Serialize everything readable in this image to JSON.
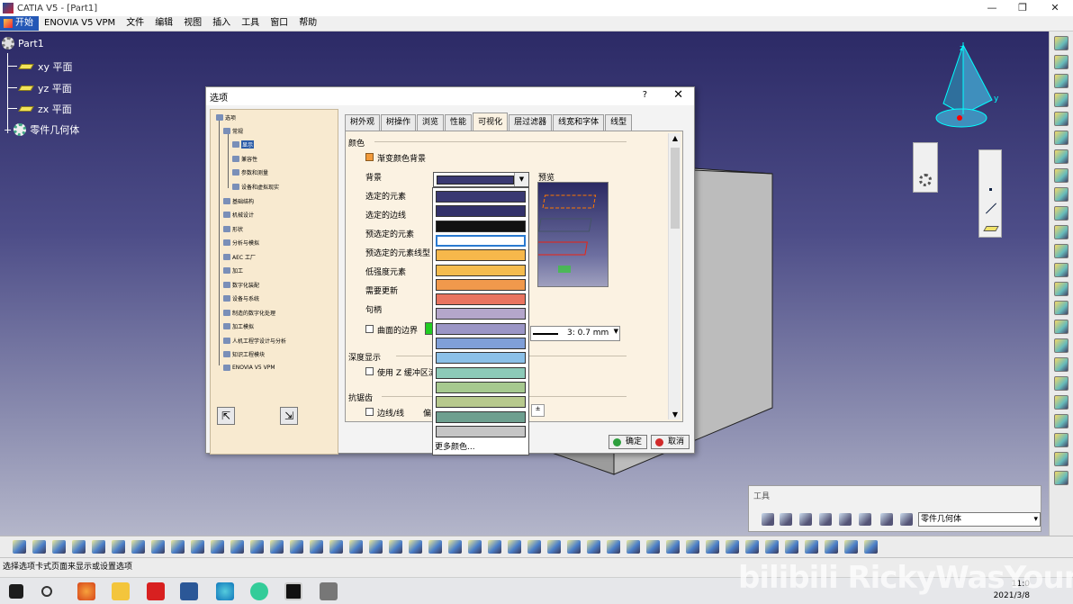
{
  "window": {
    "title": "CATIA V5 - [Part1]",
    "min": "—",
    "restore": "❐",
    "close": "✕"
  },
  "menu": {
    "start": "开始",
    "items": [
      "ENOVIA V5 VPM",
      "文件",
      "编辑",
      "视图",
      "插入",
      "工具",
      "窗口",
      "帮助"
    ]
  },
  "tree": {
    "root": "Part1",
    "planes": [
      "xy 平面",
      "yz 平面",
      "zx 平面"
    ],
    "body": "零件几何体"
  },
  "compass": {
    "x": "x",
    "y": "y",
    "z": "z"
  },
  "dialog": {
    "title": "选项",
    "help": "?",
    "close": "✕",
    "tree": [
      "选项",
      "常规",
      "显示",
      "兼容性",
      "参数和测量",
      "设备和虚拟现实",
      "基础结构",
      "机械设计",
      "形状",
      "分析与模拟",
      "AEC 工厂",
      "加工",
      "数字化装配",
      "设备与系统",
      "制造的数字化处理",
      "加工模拟",
      "人机工程学设计与分析",
      "知识工程模块",
      "ENOVIA V5 VPM"
    ],
    "tabs": [
      "树外观",
      "树操作",
      "浏览",
      "性能",
      "可视化",
      "层过滤器",
      "线宽和字体",
      "线型"
    ],
    "active_tab": "可视化",
    "section_color": "颜色",
    "gradient_bg": "渐变颜色背景",
    "color_rows": [
      "背景",
      "选定的元素",
      "选定的边线",
      "预选定的元素",
      "预选定的元素线型",
      "低强度元素",
      "需要更新",
      "句柄"
    ],
    "preview_title": "预览",
    "surface_edges": "曲面的边界",
    "line_value": "3: 0.7 mm",
    "section_depth": "深度显示",
    "zbuffer": "使用 Z 缓冲区流",
    "section_aa": "抗锯齿",
    "edge_line": "边线/线",
    "offset": "偏",
    "ok": "确定",
    "cancel": "取消"
  },
  "palette": {
    "colors": [
      "#3a3972",
      "#32316a",
      "#111111",
      "#ffffff",
      "#f7b84b",
      "#f5bc4f",
      "#f1994c",
      "#e97460",
      "#b4a6cb",
      "#9b96c6",
      "#7f9fd8",
      "#8bc0e8",
      "#8ccab8",
      "#a6c98f",
      "#b7c98d",
      "#6e9f8f",
      "#c5c5c5"
    ],
    "more": "更多颜色..."
  },
  "tools": {
    "title": "工具",
    "combo": "零件几何体"
  },
  "status": "选择选项卡式页面来显示或设置选项",
  "taskbar": {
    "time": "11:0",
    "date": "2021/3/8"
  },
  "watermark": "bilibili RickyWasYoung"
}
